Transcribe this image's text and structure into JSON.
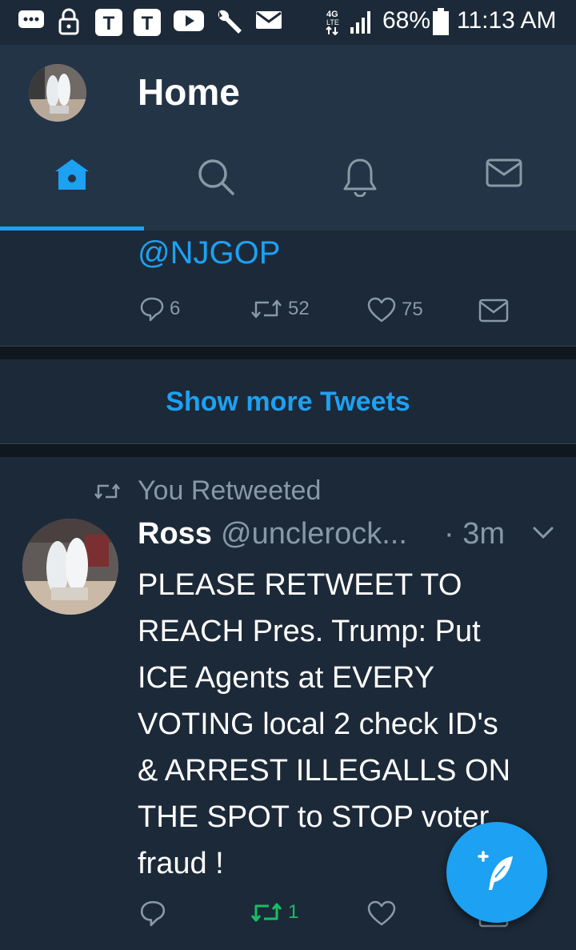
{
  "status_bar": {
    "network": "4G LTE",
    "battery": "68%",
    "time": "11:13 AM"
  },
  "header": {
    "title": "Home"
  },
  "tabs": [
    {
      "name": "home",
      "icon": "home-icon",
      "active": true
    },
    {
      "name": "search",
      "icon": "search-icon",
      "active": false
    },
    {
      "name": "notifications",
      "icon": "bell-icon",
      "active": false
    },
    {
      "name": "messages",
      "icon": "mail-icon",
      "active": false
    }
  ],
  "previous_tweet": {
    "mention": "@NJGOP",
    "replies": "6",
    "retweets": "52",
    "likes": "75"
  },
  "show_more": "Show more Tweets",
  "tweet": {
    "retweet_note": "You Retweeted",
    "name": "Ross",
    "handle": "@unclerock...",
    "time": "· 3m",
    "text_lines": [
      "PLEASE RETWEET TO",
      "REACH Pres. Trump: Put",
      "ICE Agents at EVERY",
      "VOTING local 2 check ID's",
      "& ARREST ILLEGALLS ON",
      "THE SPOT to STOP voter",
      "fraud !"
    ],
    "retweets": "1"
  },
  "colors": {
    "accent": "#1da1f2",
    "header_bg": "#243447",
    "background": "#1c2938",
    "retweet_green": "#17bf63",
    "muted": "#8899a6"
  }
}
